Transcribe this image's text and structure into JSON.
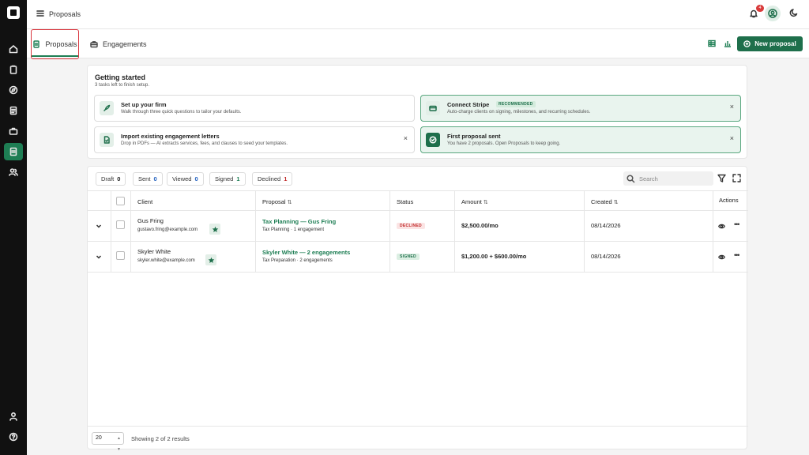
{
  "app": {
    "title": "Proposals",
    "notification_count": "4"
  },
  "tabs": [
    {
      "label": "Proposals"
    },
    {
      "label": "Engagements"
    }
  ],
  "new_proposal_label": "New proposal",
  "getting_started": {
    "title": "Getting started",
    "subtitle": "3 tasks left to finish setup.",
    "tasks": [
      {
        "title": "Set up your firm",
        "desc": "Walk through three quick questions to tailor your defaults."
      },
      {
        "title": "Connect Stripe",
        "badge": "RECOMMENDED",
        "desc": "Auto-charge clients on signing, milestones, and recurring schedules."
      },
      {
        "title": "Import existing engagement letters",
        "desc": "Drop in PDFs — AI extracts services, fees, and clauses to seed your templates."
      },
      {
        "title": "First proposal sent",
        "desc": "You have 2 proposals. Open Proposals to keep going."
      }
    ]
  },
  "filters": [
    {
      "label": "Draft",
      "count": "0",
      "color": "#222222"
    },
    {
      "label": "Sent",
      "count": "0",
      "color": "#1f5fbf"
    },
    {
      "label": "Viewed",
      "count": "0",
      "color": "#1f5fbf"
    },
    {
      "label": "Signed",
      "count": "1",
      "color": "#1e7e54"
    },
    {
      "label": "Declined",
      "count": "1",
      "color": "#c22c2c"
    }
  ],
  "search": {
    "placeholder": "Search"
  },
  "columns": {
    "client": "Client",
    "proposal": "Proposal",
    "status": "Status",
    "amount": "Amount",
    "created": "Created",
    "actions": "Actions"
  },
  "rows": [
    {
      "client": "Gus Fring",
      "email": "gustavo.fring@example.com",
      "proposal": "Tax Planning — Gus Fring",
      "sub": "Tax Planning · 1 engagement",
      "status": "DECLINED",
      "amount": "$2,500.00/mo",
      "created": "08/14/2026"
    },
    {
      "client": "Skyler White",
      "email": "skyler.white@example.com",
      "proposal": "Skyler White — 2 engagements",
      "sub": "Tax Preparation · 2 engagements",
      "status": "SIGNED",
      "amount": "$1,200.00 + $600.00/mo",
      "created": "08/14/2026"
    }
  ],
  "footer": {
    "page_size": "20",
    "showing": "Showing 2 of 2 results"
  },
  "colors": {
    "accent": "#1e6f4b",
    "declined": "#c22c2c",
    "sidebar": "#111111"
  }
}
